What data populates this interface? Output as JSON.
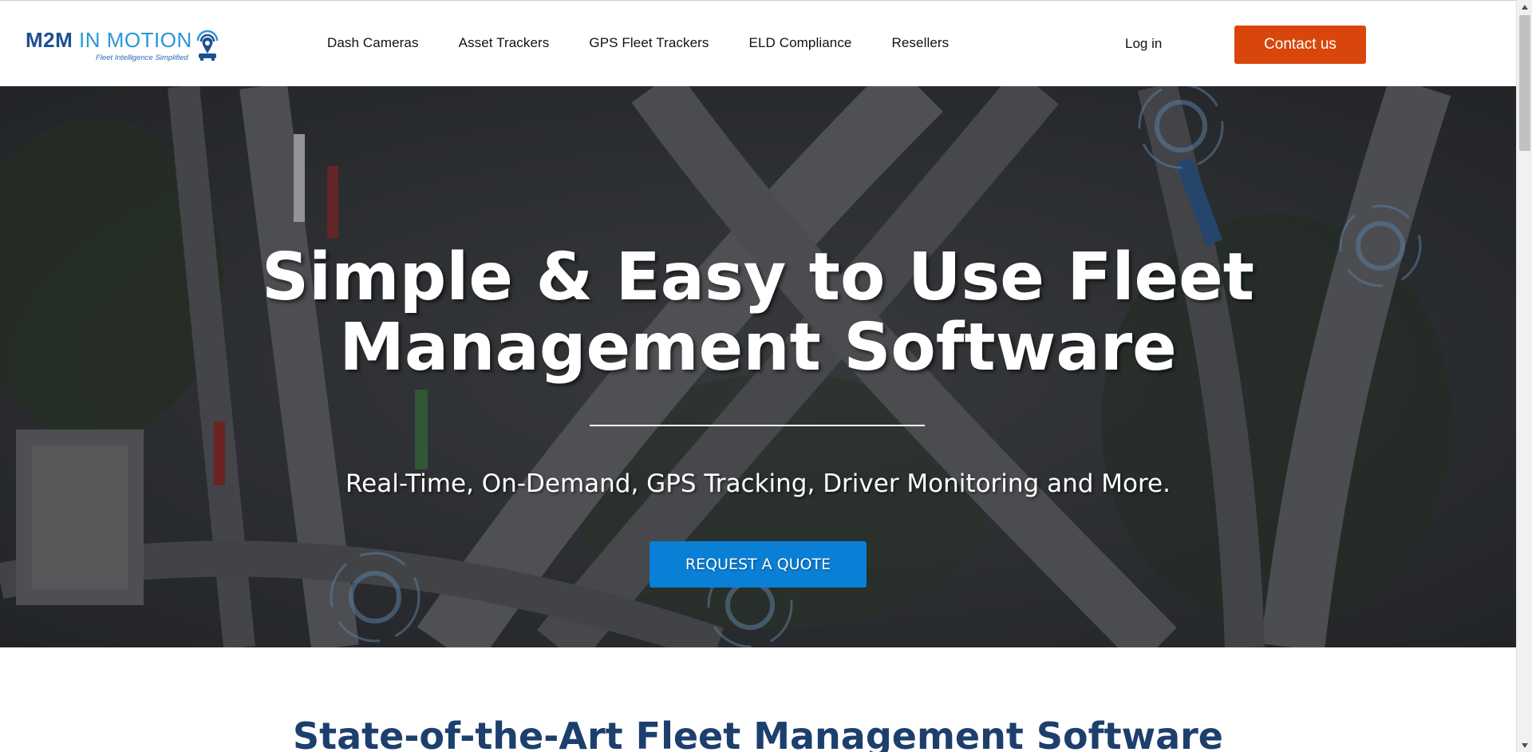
{
  "brand": {
    "name_part1": "M2M",
    "name_part2": " IN MOTION",
    "tagline": "Fleet Intelligence Simplified",
    "primary_color": "#1c4f91",
    "accent_color": "#2a98d8"
  },
  "nav": {
    "items": [
      {
        "label": "Dash Cameras"
      },
      {
        "label": "Asset Trackers"
      },
      {
        "label": "GPS Fleet Trackers"
      },
      {
        "label": "ELD Compliance"
      },
      {
        "label": "Resellers"
      }
    ],
    "login_label": "Log in",
    "contact_label": "Contact us",
    "contact_color": "#d9460b"
  },
  "hero": {
    "title_line1": "Simple & Easy to Use Fleet",
    "title_line2": "Management Software",
    "subtitle": "Real-Time, On-Demand, GPS Tracking, Driver Monitoring and More.",
    "cta_label": "REQUEST A QUOTE",
    "cta_color": "#0a7fd6"
  },
  "section": {
    "title": "State-of-the-Art Fleet Management Software"
  },
  "icons": {
    "logo_icon": "signal-pin-icon",
    "scroll_up": "chevron-up-icon",
    "scroll_down": "chevron-down-icon"
  }
}
